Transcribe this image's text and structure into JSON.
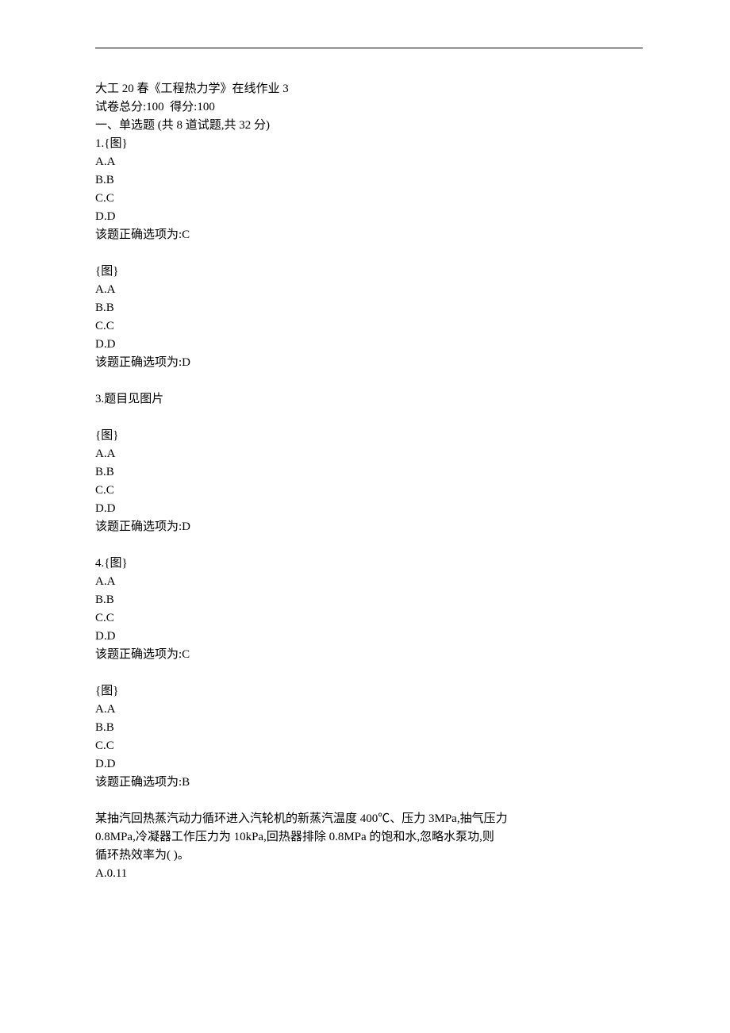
{
  "header": {
    "course_title": "大工 20 春《工程热力学》在线作业 3",
    "total_score": "试卷总分:100  得分:100",
    "section_title": "一、单选题 (共 8 道试题,共 32 分)"
  },
  "questions": [
    {
      "prefix": "1.",
      "stem": "{图}",
      "options": [
        "A.A",
        "B.B",
        "C.C",
        "D.D"
      ],
      "answer_label": "该题正确选项为:",
      "answer": "C"
    },
    {
      "prefix": "",
      "stem": "{图}",
      "options": [
        "A.A",
        "B.B",
        "C.C",
        "D.D"
      ],
      "answer_label": "该题正确选项为:",
      "answer": "D"
    },
    {
      "prefix": "3.",
      "stem": "题目见图片",
      "extra": "{图}",
      "options": [
        "A.A",
        "B.B",
        "C.C",
        "D.D"
      ],
      "answer_label": "该题正确选项为:",
      "answer": "D"
    },
    {
      "prefix": "4.",
      "stem": "{图}",
      "options": [
        "A.A",
        "B.B",
        "C.C",
        "D.D"
      ],
      "answer_label": "该题正确选项为:",
      "answer": "C"
    },
    {
      "prefix": "",
      "stem": "{图}",
      "options": [
        "A.A",
        "B.B",
        "C.C",
        "D.D"
      ],
      "answer_label": "该题正确选项为:",
      "answer": "B"
    }
  ],
  "essay_question": {
    "line1": "某抽汽回热蒸汽动力循环进入汽轮机的新蒸汽温度 400℃、压力 3MPa,抽气压力",
    "line2": "0.8MPa,冷凝器工作压力为 10kPa,回热器排除 0.8MPa 的饱和水,忽略水泵功,则",
    "line3": "循环热效率为( )。",
    "option_a": "A.0.11"
  }
}
